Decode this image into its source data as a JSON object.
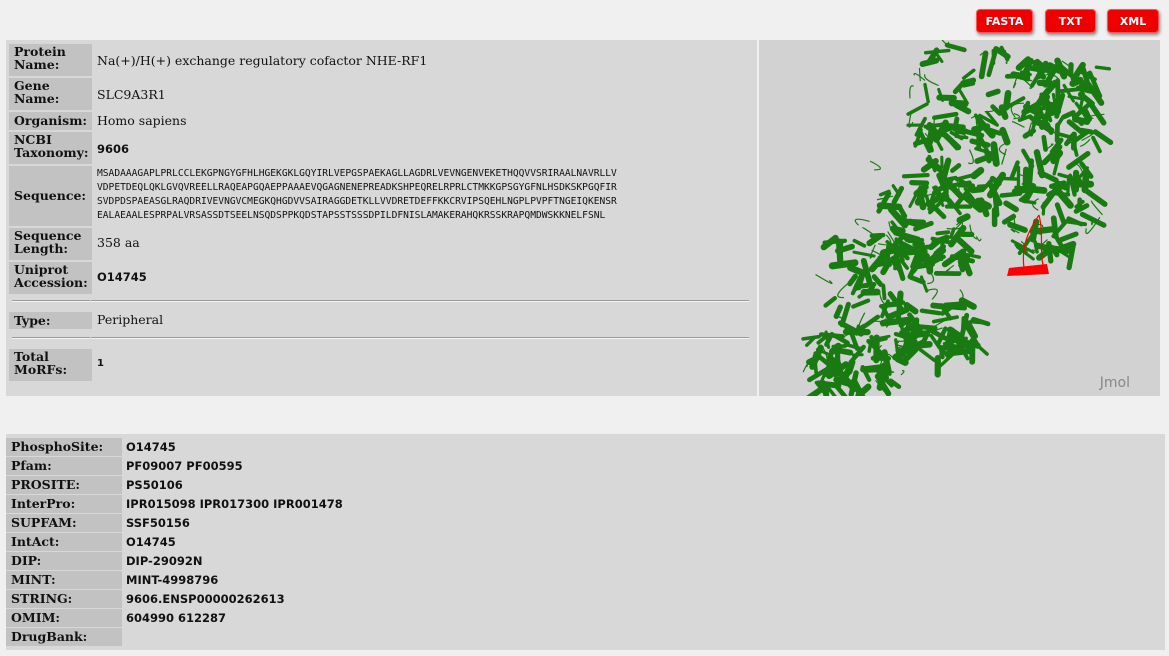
{
  "export_buttons": {
    "fasta": "FASTA",
    "txt": "TXT",
    "xml": "XML"
  },
  "protein": {
    "name_label_1": "Protein",
    "name_label_2": "Name:",
    "name": "Na(+)/H(+) exchange regulatory cofactor NHE-RF1",
    "gene_label_1": "Gene",
    "gene_label_2": "Name:",
    "gene": "SLC9A3R1",
    "organism_label": "Organism:",
    "organism": "Homo sapiens",
    "taxonomy_label_1": "NCBI",
    "taxonomy_label_2": "Taxonomy:",
    "taxonomy": "9606",
    "sequence_label": "Sequence:",
    "sequence_lines": [
      "MSADAAAGAPLPRLCCLEKGPNGYGFHLHGEKGKLGQYIRLVEPGSPAEKAGLLAGDRLVEVNGENVEKETHQQVVSRIRAALNAVRLLV",
      "VDPETDEQLQKLGVQVREELLRAQEAPGQAEPPAAAEVQGAGNENEPREADKSHPEQRELRPRLCTMKKGPSGYGFNLHSDKSKPGQFIR",
      "SVDPDSPAEASGLRAQDRIVEVNGVCMEGKQHGDVVSAIRAGGDETKLLVVDRETDEFFKKCRVIPSQEHLNGPLPVPFTNGEIQKENSR",
      "EALAEAALESPRPALVRSASSDTSEELNSQDSPPKQDSTAPSSTSSSDPILDFNISLAMAKERAHQKRSSKRAPQMDWSKKNELFSNL"
    ],
    "length_label_1": "Sequence",
    "length_label_2": "Length:",
    "length": "358 aa",
    "accession_label_1": "Uniprot",
    "accession_label_2": "Accession:",
    "accession": "O14745",
    "type_label": "Type:",
    "type": "Peripheral",
    "morfs_label_1": "Total",
    "morfs_label_2": "MoRFs:",
    "morfs": "1"
  },
  "viewer": {
    "label": "Jmol",
    "ribbon_color": "#1a7a12",
    "highlight_color": "#ff0000"
  },
  "cross_refs": [
    {
      "label": "PhosphoSite:",
      "value": "O14745"
    },
    {
      "label": "Pfam:",
      "value": "PF09007 PF00595"
    },
    {
      "label": "PROSITE:",
      "value": "PS50106"
    },
    {
      "label": "InterPro:",
      "value": "IPR015098 IPR017300 IPR001478"
    },
    {
      "label": "SUPFAM:",
      "value": "SSF50156"
    },
    {
      "label": "IntAct:",
      "value": "O14745"
    },
    {
      "label": "DIP:",
      "value": "DIP-29092N"
    },
    {
      "label": "MINT:",
      "value": "MINT-4998796"
    },
    {
      "label": "STRING:",
      "value": "9606.ENSP00000262613"
    },
    {
      "label": "OMIM:",
      "value": "604990 612287"
    },
    {
      "label": "DrugBank:",
      "value": ""
    }
  ]
}
